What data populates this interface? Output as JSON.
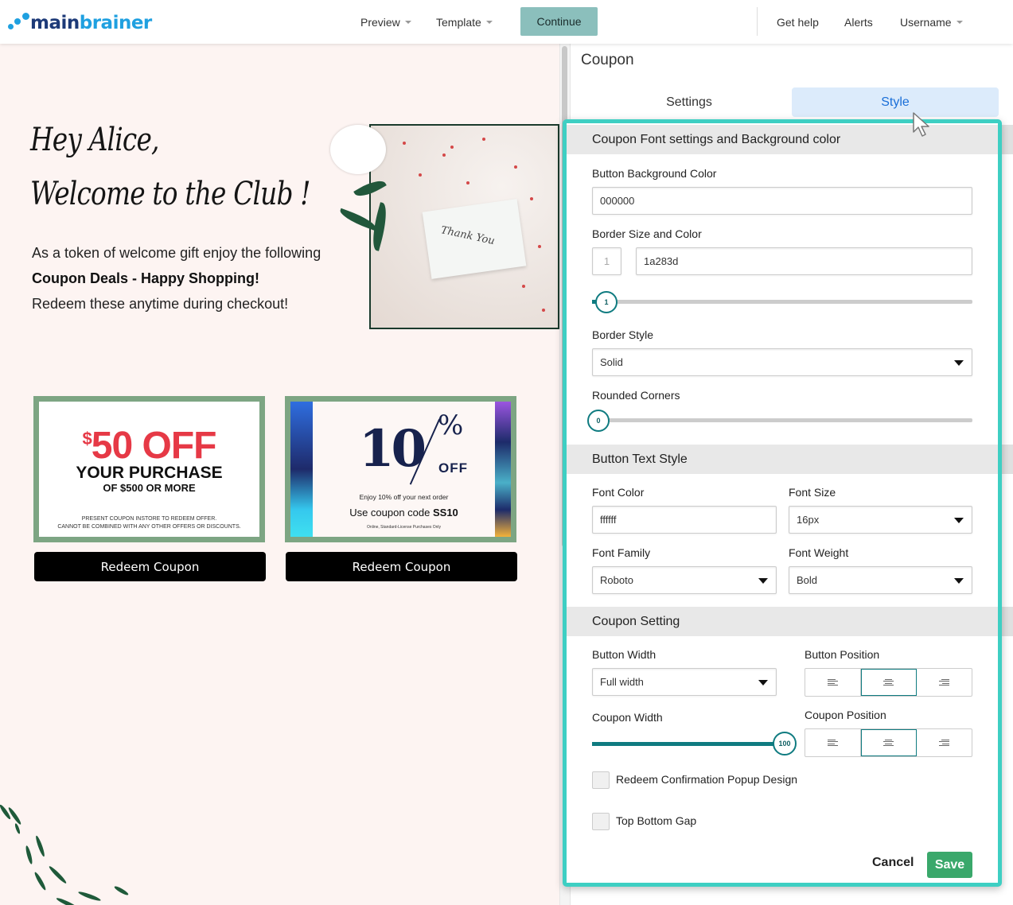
{
  "brand": {
    "name_part1": "main",
    "name_part2": "brainer"
  },
  "topnav": {
    "preview": "Preview",
    "template": "Template",
    "continue": "Continue",
    "get_help": "Get help",
    "alerts": "Alerts",
    "username": "Username"
  },
  "email": {
    "greeting_line1": "Hey Alice,",
    "greeting_line2": "Welcome to the Club !",
    "intro_part1": "As a token of welcome gift enjoy the following ",
    "intro_bold": "Coupon Deals - Happy Shopping!",
    "intro_part2": "Redeem these anytime during checkout!",
    "photo_card_text": "Thank You",
    "coupons": [
      {
        "amount_symbol": "$",
        "amount": "50 OFF",
        "line2": "YOUR PURCHASE",
        "line3": "OF $500 OR MORE",
        "fine1": "PRESENT COUPON INSTORE TO REDEEM OFFER.",
        "fine2": "CANNOT BE COMBINED WITH ANY OTHER OFFERS OR DISCOUNTS.",
        "button": "Redeem Coupon"
      },
      {
        "big": "10",
        "pct": "%",
        "off": "OFF",
        "line1": "Enjoy 10% off your next order",
        "line2_prefix": "Use coupon code ",
        "code": "SS10",
        "line3": "Online, Standard-License Purchases Only",
        "button": "Redeem Coupon"
      }
    ]
  },
  "panel": {
    "title": "Coupon",
    "tabs": [
      {
        "label": "Settings",
        "active": false
      },
      {
        "label": "Style",
        "active": true
      }
    ],
    "section1": {
      "title": "Coupon Font settings and Background color",
      "button_bg_label": "Button Background Color",
      "button_bg_value": "000000",
      "border_label": "Border Size and Color",
      "border_size": "1",
      "border_color": "1a283d",
      "border_slider_value": "1",
      "border_style_label": "Border Style",
      "border_style_value": "Solid",
      "rounded_label": "Rounded Corners",
      "rounded_value": "0"
    },
    "section2": {
      "title": "Button Text Style",
      "font_color_label": "Font Color",
      "font_color_value": "ffffff",
      "font_size_label": "Font Size",
      "font_size_value": "16px",
      "font_family_label": "Font Family",
      "font_family_value": "Roboto",
      "font_weight_label": "Font Weight",
      "font_weight_value": "Bold"
    },
    "section3": {
      "title": "Coupon Setting",
      "button_width_label": "Button Width",
      "button_width_value": "Full width",
      "button_position_label": "Button Position",
      "button_position_active": "center",
      "coupon_width_label": "Coupon Width",
      "coupon_width_value": "100",
      "coupon_position_label": "Coupon Position",
      "coupon_position_active": "center",
      "redeem_popup_label": "Redeem Confirmation Popup Design",
      "redeem_popup_checked": false,
      "top_bottom_gap_label": "Top Bottom Gap",
      "top_bottom_gap_checked": false
    },
    "cancel": "Cancel",
    "save": "Save"
  },
  "colors": {
    "highlight": "#3ecfc3",
    "accent_teal": "#0f7b80",
    "continue_bg": "#8bbfbc",
    "save_bg": "#3aa86b",
    "style_tab_bg": "#dcebfb",
    "style_tab_text": "#1a6fd8",
    "canvas_bg": "#fdf4f2",
    "coupon_frame": "#7da583"
  }
}
